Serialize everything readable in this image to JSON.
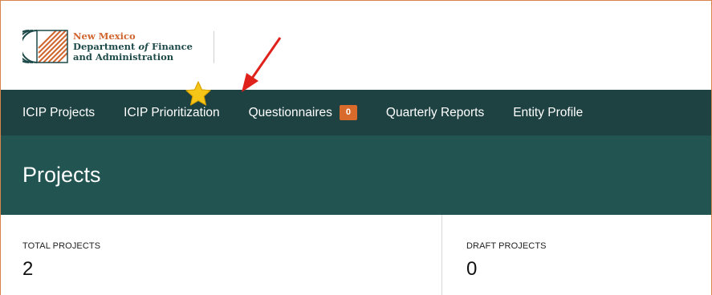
{
  "logo": {
    "line1": "New Mexico",
    "line2_prefix": "Department ",
    "line2_italic": "of",
    "line2_suffix": " Finance",
    "line3": "and Administration"
  },
  "nav": {
    "items": [
      {
        "label": "ICIP Projects"
      },
      {
        "label": "ICIP Prioritization"
      },
      {
        "label": "Questionnaires",
        "badge": "0"
      },
      {
        "label": "Quarterly Reports"
      },
      {
        "label": "Entity Profile"
      }
    ]
  },
  "page": {
    "title": "Projects"
  },
  "stats": [
    {
      "label": "TOTAL PROJECTS",
      "value": "2"
    },
    {
      "label": "DRAFT PROJECTS",
      "value": "0"
    }
  ],
  "colors": {
    "nav_bg": "#1e4142",
    "title_bg": "#225452",
    "accent_orange": "#d86a2c",
    "annotation_arrow": "#e0221c",
    "star": "#f5c518"
  },
  "icons": {
    "logo_mark": "nm-dfa-logo-icon",
    "annotation": "red-arrow-icon",
    "highlight": "star-icon"
  }
}
